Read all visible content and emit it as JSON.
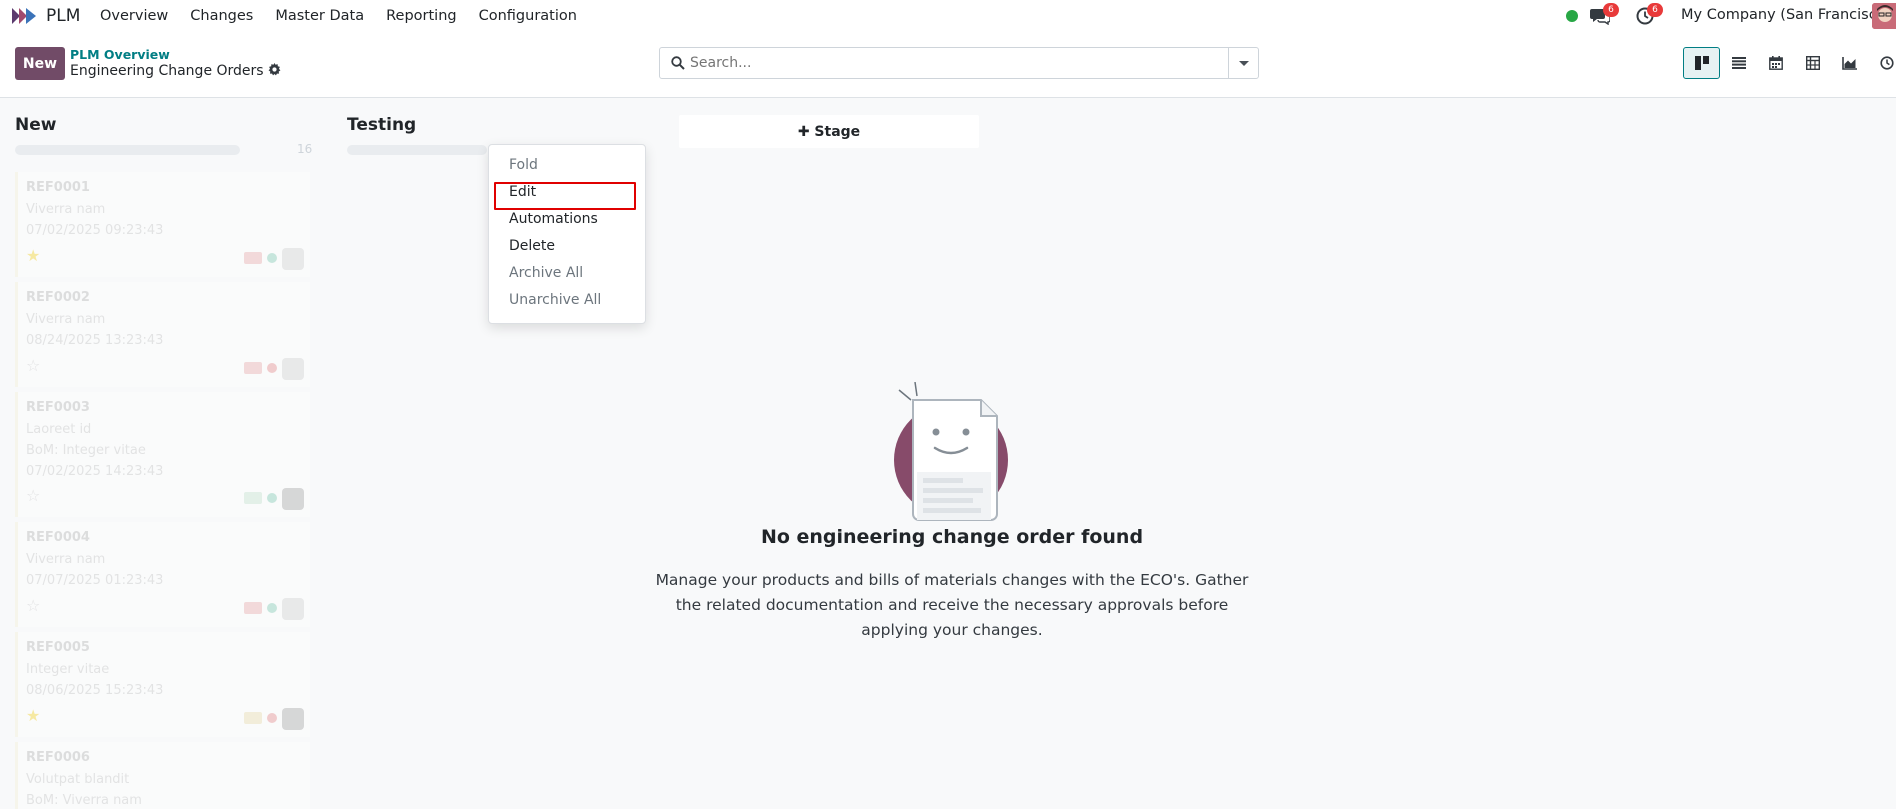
{
  "navbar": {
    "app_name": "PLM",
    "menu": [
      "Overview",
      "Changes",
      "Master Data",
      "Reporting",
      "Configuration"
    ],
    "messages_badge": "6",
    "activities_badge": "6",
    "company": "My Company (San Francisco)",
    "presence_color": "#28a745"
  },
  "control": {
    "new_label": "New",
    "breadcrumb": "PLM Overview",
    "title": "Engineering Change Orders",
    "search_placeholder": "Search...",
    "views": [
      "kanban-icon",
      "list-icon",
      "calendar-icon",
      "pivot-icon",
      "graph-icon",
      "activity-icon"
    ]
  },
  "kanban": {
    "columns": [
      {
        "title": "New",
        "count": "16"
      },
      {
        "title": "Testing"
      }
    ],
    "add_stage_label": "Stage",
    "cards": [
      {
        "ref": "REF0001",
        "line1": "Viverra nam",
        "line2": "07/02/2025 09:23:43"
      },
      {
        "ref": "REF0002",
        "line1": "Viverra nam",
        "line2": "08/24/2025 13:23:43"
      },
      {
        "ref": "REF0003",
        "line1": "Laoreet id",
        "line2": "BoM: Integer vitae",
        "line3": "07/02/2025 14:23:43"
      },
      {
        "ref": "REF0004",
        "line1": "Viverra nam",
        "line2": "07/07/2025 01:23:43"
      },
      {
        "ref": "REF0005",
        "line1": "Integer vitae",
        "line2": "08/06/2025 15:23:43"
      },
      {
        "ref": "REF0006",
        "line1": "Volutpat blandit",
        "line2": "BoM: Viverra nam"
      }
    ]
  },
  "stage_menu": {
    "items": [
      "Fold",
      "Edit",
      "Automations",
      "Delete",
      "Archive All",
      "Unarchive All"
    ],
    "highlight_color": "#e00000"
  },
  "empty_state": {
    "title": "No engineering change order found",
    "text": "Manage your products and bills of materials changes with the ECO's. Gather the related documentation and receive the necessary approvals before applying your changes."
  },
  "colors": {
    "brand": "#714b67",
    "accent": "#017e84",
    "badge": "#e83a3a"
  }
}
